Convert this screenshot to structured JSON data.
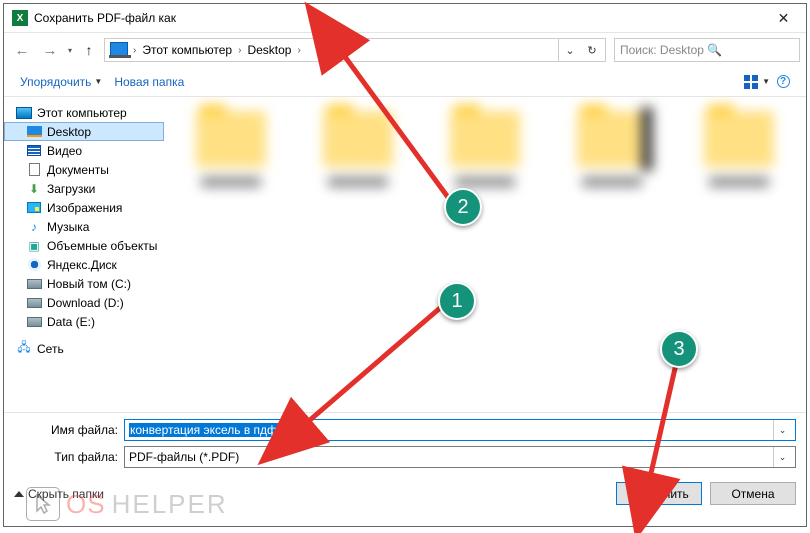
{
  "window": {
    "title": "Сохранить PDF-файл как",
    "app_icon_letter": "X"
  },
  "breadcrumb": {
    "root": "Этот компьютер",
    "leaf": "Desktop"
  },
  "search": {
    "placeholder": "Поиск: Desktop"
  },
  "toolbar": {
    "organize": "Упорядочить",
    "new_folder": "Новая папка"
  },
  "tree": {
    "root": "Этот компьютер",
    "items": [
      "Desktop",
      "Видео",
      "Документы",
      "Загрузки",
      "Изображения",
      "Музыка",
      "Объемные объекты",
      "Яндекс.Диск",
      "Новый том (C:)",
      "Download (D:)",
      "Data (E:)"
    ],
    "network": "Сеть"
  },
  "fields": {
    "name_label": "Имя файла:",
    "name_value": "конвертация эксель в пдф.pdf",
    "type_label": "Тип файла:",
    "type_value": "PDF-файлы (*.PDF)"
  },
  "footer": {
    "hide_folders": "Скрыть папки",
    "save": "Сохранить",
    "cancel": "Отмена"
  },
  "annotations": {
    "c1": "1",
    "c2": "2",
    "c3": "3"
  },
  "watermark": {
    "part1": "OS",
    "part2": "HELPER"
  }
}
